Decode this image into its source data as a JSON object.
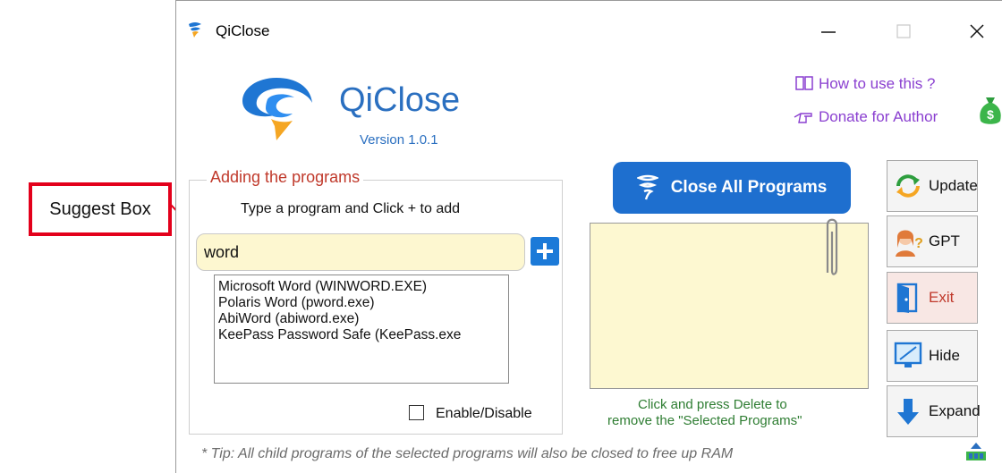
{
  "window": {
    "title": "QiClose"
  },
  "brand": {
    "name": "QiClose",
    "version": "Version 1.0.1"
  },
  "links": {
    "howto": "How to use this ?",
    "donate": "Donate for Author"
  },
  "adding": {
    "legend": "Adding the programs",
    "hint": "Type a program and Click + to add",
    "input_value": "word",
    "suggestions": [
      "Microsoft Word (WINWORD.EXE)",
      "Polaris Word (pword.exe)",
      "AbiWord (abiword.exe)",
      "KeePass Password Safe (KeePass.exe"
    ],
    "enable_label": "Enable/Disable"
  },
  "selected": {
    "close_all_label": "Close All Programs",
    "hint_line1": "Click and press Delete to",
    "hint_line2": "remove the \"Selected Programs\""
  },
  "side_buttons": {
    "update": "Update",
    "gpt": "GPT",
    "exit": "Exit",
    "hide": "Hide",
    "expand": "Expand"
  },
  "tip": "* Tip: All child programs of the selected programs will also be closed to free up RAM",
  "annotation": {
    "label": "Suggest Box"
  },
  "colors": {
    "accent_blue": "#1e6fcf",
    "link_purple": "#8a3fd0",
    "legend_red": "#c0392b",
    "hint_green": "#2e7d32",
    "input_yellow": "#fdf7d0",
    "annotation_red": "#e3001b"
  },
  "icons": {
    "title": "qiclose-logo-icon",
    "howto": "book-icon",
    "donate": "pointing-hand-icon",
    "money": "money-bag-icon",
    "add": "plus-icon",
    "close_all": "tornado-icon",
    "clip": "paperclip-icon",
    "update": "refresh-icon",
    "gpt": "assistant-avatar-icon",
    "exit": "door-icon",
    "hide": "monitor-icon",
    "expand": "arrow-down-icon",
    "tip": "ram-chip-icon"
  }
}
